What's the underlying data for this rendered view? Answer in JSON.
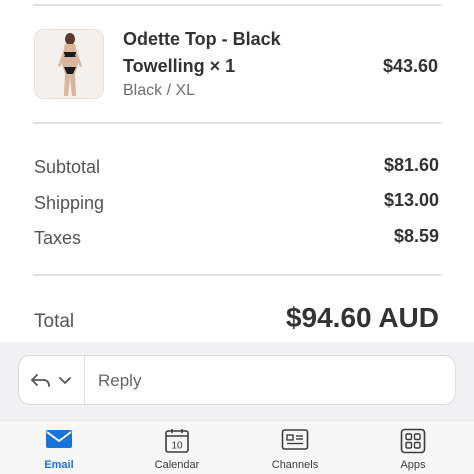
{
  "line_item": {
    "name": "Odette Top - Black Towelling × 1",
    "variant": "Black / XL",
    "price": "$43.60"
  },
  "summary": {
    "subtotal_label": "Subtotal",
    "subtotal_value": "$81.60",
    "shipping_label": "Shipping",
    "shipping_value": "$13.00",
    "taxes_label": "Taxes",
    "taxes_value": "$8.59",
    "total_label": "Total",
    "total_value": "$94.60 AUD"
  },
  "reply": {
    "label": "Reply"
  },
  "tabs": [
    {
      "label": "Email",
      "icon": "mail-icon",
      "active": true
    },
    {
      "label": "Calendar",
      "icon": "calendar-icon",
      "day": "10",
      "active": false
    },
    {
      "label": "Channels",
      "icon": "channels-icon",
      "active": false
    },
    {
      "label": "Apps",
      "icon": "apps-icon",
      "active": false
    }
  ],
  "colors": {
    "accent": "#1a73d9",
    "text": "#333333",
    "muted": "#707070"
  }
}
